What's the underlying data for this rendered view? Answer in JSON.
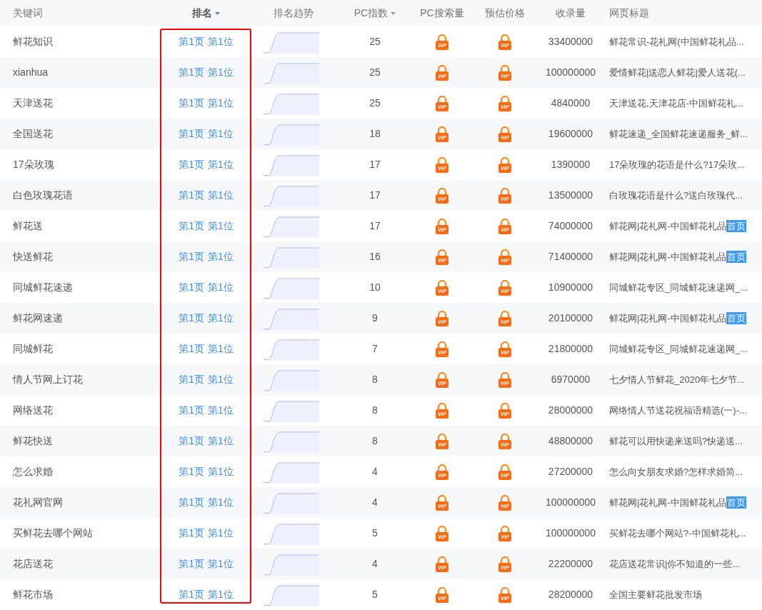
{
  "columns": [
    {
      "label": "关键词",
      "sortable": false,
      "sorted": false
    },
    {
      "label": "排名",
      "sortable": true,
      "sorted": true
    },
    {
      "label": "排名趋势",
      "sortable": false,
      "sorted": false
    },
    {
      "label": "PC指数",
      "sortable": true,
      "sorted": false
    },
    {
      "label": "PC搜索量",
      "sortable": false,
      "sorted": false
    },
    {
      "label": "预估价格",
      "sortable": false,
      "sorted": false
    },
    {
      "label": "收录量",
      "sortable": false,
      "sorted": false
    },
    {
      "label": "网页标题",
      "sortable": false,
      "sorted": false
    }
  ],
  "rows": [
    {
      "keyword": "鲜花知识",
      "page": "第1页",
      "position": "第1位",
      "index": "25",
      "pc_search": "VIP",
      "price": "VIP",
      "indexed": "33400000",
      "title": "鲜花常识-花礼网(中国鲜花礼品..."
    },
    {
      "keyword": "xianhua",
      "page": "第1页",
      "position": "第1位",
      "index": "25",
      "pc_search": "VIP",
      "price": "VIP",
      "indexed": "100000000",
      "title": "爱情鲜花|送恋人鲜花|爱人送花(..."
    },
    {
      "keyword": "天津送花",
      "page": "第1页",
      "position": "第1位",
      "index": "25",
      "pc_search": "VIP",
      "price": "VIP",
      "indexed": "4840000",
      "title": "天津送花,天津花店-中国鲜花礼..."
    },
    {
      "keyword": "全国送花",
      "page": "第1页",
      "position": "第1位",
      "index": "18",
      "pc_search": "VIP",
      "price": "VIP",
      "indexed": "19600000",
      "title": "鲜花速递_全国鲜花速递服务_鲜..."
    },
    {
      "keyword": "17朵玫瑰",
      "page": "第1页",
      "position": "第1位",
      "index": "17",
      "pc_search": "VIP",
      "price": "VIP",
      "indexed": "1390000",
      "title": "17朵玫瑰的花语是什么?17朵玫..."
    },
    {
      "keyword": "白色玫瑰花语",
      "page": "第1页",
      "position": "第1位",
      "index": "17",
      "pc_search": "VIP",
      "price": "VIP",
      "indexed": "13500000",
      "title": "白玫瑰花语是什么?送白玫瑰代..."
    },
    {
      "keyword": "鲜花送",
      "page": "第1页",
      "position": "第1位",
      "index": "17",
      "pc_search": "VIP",
      "price": "VIP",
      "indexed": "74000000",
      "title": "鲜花网|花礼网-中国鲜花礼品",
      "badge": "首页"
    },
    {
      "keyword": "快送鲜花",
      "page": "第1页",
      "position": "第1位",
      "index": "16",
      "pc_search": "VIP",
      "price": "VIP",
      "indexed": "71400000",
      "title": "鲜花网|花礼网-中国鲜花礼品",
      "badge": "首页"
    },
    {
      "keyword": "同城鲜花速递",
      "page": "第1页",
      "position": "第1位",
      "index": "10",
      "pc_search": "VIP",
      "price": "VIP",
      "indexed": "10900000",
      "title": "同城鲜花专区_同城鲜花速递网_..."
    },
    {
      "keyword": "鲜花网速递",
      "page": "第1页",
      "position": "第1位",
      "index": "9",
      "pc_search": "VIP",
      "price": "VIP",
      "indexed": "20100000",
      "title": "鲜花网|花礼网-中国鲜花礼品",
      "badge": "首页"
    },
    {
      "keyword": "同城鲜花",
      "page": "第1页",
      "position": "第1位",
      "index": "7",
      "pc_search": "VIP",
      "price": "VIP",
      "indexed": "21800000",
      "title": "同城鲜花专区_同城鲜花速递网_..."
    },
    {
      "keyword": "情人节网上订花",
      "page": "第1页",
      "position": "第1位",
      "index": "8",
      "pc_search": "VIP",
      "price": "VIP",
      "indexed": "6970000",
      "title": "七夕情人节鲜花_2020年七夕节..."
    },
    {
      "keyword": "网络送花",
      "page": "第1页",
      "position": "第1位",
      "index": "8",
      "pc_search": "VIP",
      "price": "VIP",
      "indexed": "28000000",
      "title": "网络情人节送花祝福语精选(一)-..."
    },
    {
      "keyword": "鲜花快送",
      "page": "第1页",
      "position": "第1位",
      "index": "8",
      "pc_search": "VIP",
      "price": "VIP",
      "indexed": "48800000",
      "title": "鲜花可以用快递来送吗?快递送..."
    },
    {
      "keyword": "怎么求婚",
      "page": "第1页",
      "position": "第1位",
      "index": "4",
      "pc_search": "VIP",
      "price": "VIP",
      "indexed": "27200000",
      "title": "怎么向女朋友求婚?怎样求婚简..."
    },
    {
      "keyword": "花礼网官网",
      "page": "第1页",
      "position": "第1位",
      "index": "4",
      "pc_search": "VIP",
      "price": "VIP",
      "indexed": "100000000",
      "title": "鲜花网|花礼网-中国鲜花礼品",
      "badge": "首页"
    },
    {
      "keyword": "买鲜花去哪个网站",
      "page": "第1页",
      "position": "第1位",
      "index": "5",
      "pc_search": "VIP",
      "price": "VIP",
      "indexed": "100000000",
      "title": "买鲜花去哪个网站?-中国鲜花礼..."
    },
    {
      "keyword": "花店送花",
      "page": "第1页",
      "position": "第1位",
      "index": "4",
      "pc_search": "VIP",
      "price": "VIP",
      "indexed": "22200000",
      "title": "花店送花常识|你不知道的一些..."
    },
    {
      "keyword": "鲜花市场",
      "page": "第1页",
      "position": "第1位",
      "index": "5",
      "pc_search": "VIP",
      "price": "VIP",
      "indexed": "28200000",
      "title": "全国主要鲜花批发市场"
    }
  ]
}
